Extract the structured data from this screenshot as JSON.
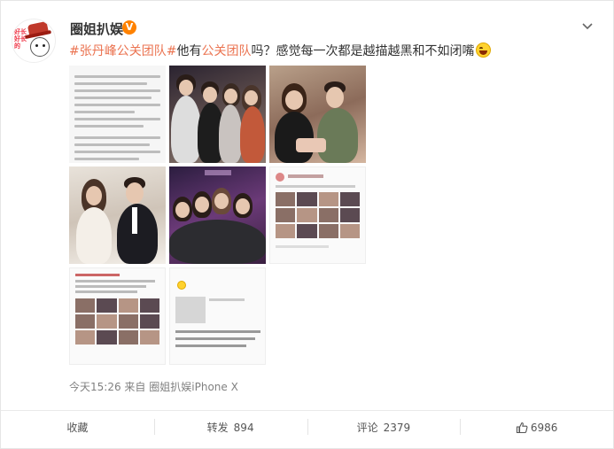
{
  "author": {
    "name": "圈姐扒娱",
    "verified_badge": "V",
    "avatar_text": "好长好长的"
  },
  "post": {
    "tag1": "#张丹峰公关团队#",
    "text1": "他有",
    "tag2": "公关团队",
    "text2": "吗？感觉每一次都是越描越黑和不如闭嘴",
    "emoji": "laughing-emoji"
  },
  "meta": {
    "time": "今天15:26",
    "from_label": "来自",
    "source": "圈姐扒娱iPhone X"
  },
  "actions": {
    "favorite": "收藏",
    "repost_label": "转发",
    "repost_count": "894",
    "comment_label": "评论",
    "comment_count": "2379",
    "like_count": "6986"
  },
  "colors": {
    "accent": "#eb7350",
    "verified": "#ff8200"
  }
}
